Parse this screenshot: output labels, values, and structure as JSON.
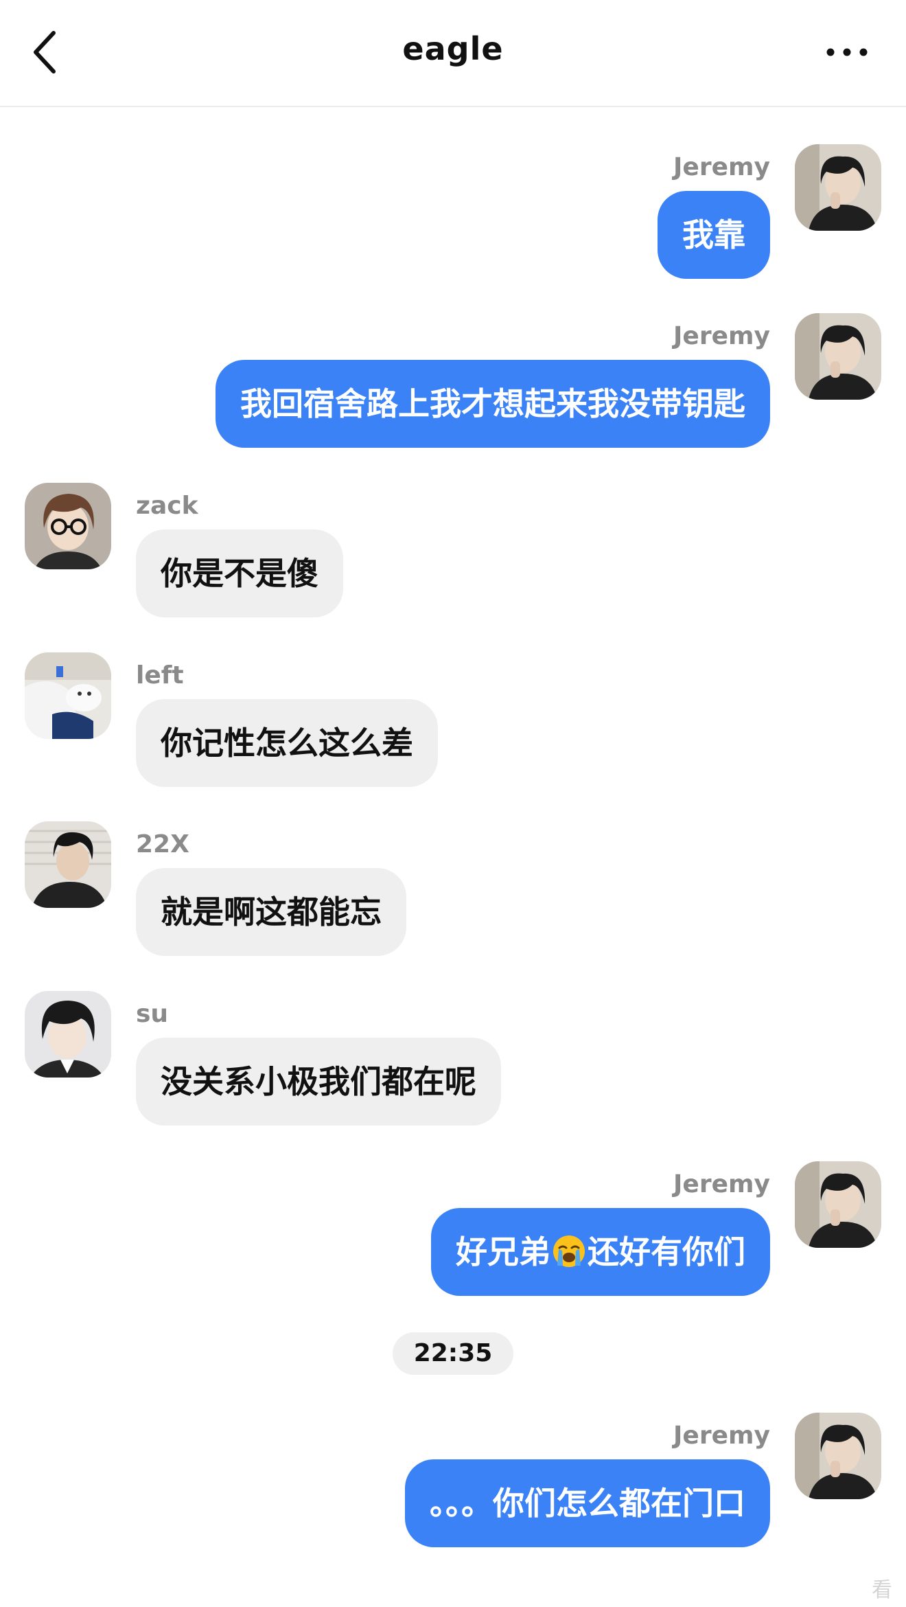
{
  "header": {
    "back_icon": "chevron-left-icon",
    "title": "eagle",
    "more_icon": "more-horizontal-icon"
  },
  "messages": [
    {
      "direction": "outgoing",
      "sender": "Jeremy",
      "text": "我靠"
    },
    {
      "direction": "outgoing",
      "sender": "Jeremy",
      "text": "我回宿舍路上我才想起来我没带钥匙"
    },
    {
      "direction": "incoming",
      "sender": "zack",
      "text": "你是不是傻"
    },
    {
      "direction": "incoming",
      "sender": "left",
      "text": "你记性怎么这么差"
    },
    {
      "direction": "incoming",
      "sender": "22X",
      "text": "就是啊这都能忘"
    },
    {
      "direction": "incoming",
      "sender": "su",
      "text": "没关系小极我们都在呢"
    },
    {
      "direction": "outgoing",
      "sender": "Jeremy",
      "text_before_emoji": "好兄弟",
      "emoji": "loudly-crying-face-icon",
      "text_after_emoji": "还好有你们"
    },
    {
      "direction": "outgoing",
      "sender": "Jeremy",
      "text": "。。。你们怎么都在门口"
    }
  ],
  "timestamp": "22:35",
  "watermark": "看",
  "colors": {
    "outgoing_bubble": "#3a82f6",
    "incoming_bubble": "#efefef",
    "name_text": "#8a8a8a"
  }
}
